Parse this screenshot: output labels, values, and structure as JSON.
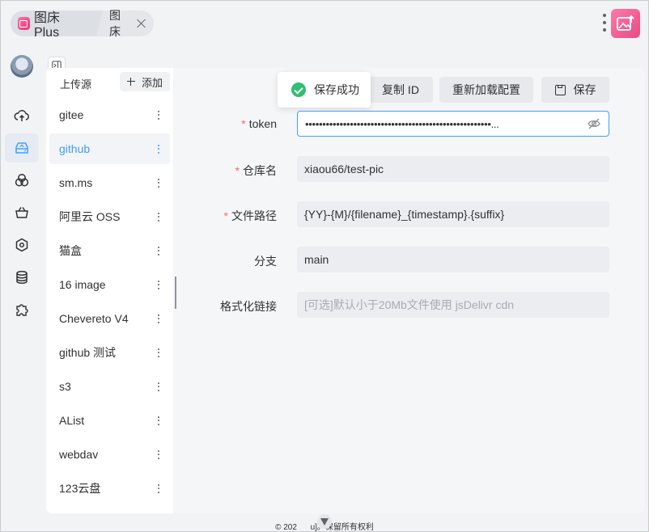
{
  "tabs": [
    {
      "label": "图床 Plus",
      "active": true
    },
    {
      "label": "图床",
      "active": false
    }
  ],
  "sidebar": {
    "title": "上传源",
    "add_label": "添加",
    "items": [
      "gitee",
      "github",
      "sm.ms",
      "阿里云 OSS",
      "猫盒",
      "16 image",
      "Chevereto V4",
      "github 测试",
      "s3",
      "AList",
      "webdav",
      "123云盘"
    ],
    "active_index": 1
  },
  "rail_icons": [
    "cloud-upload-icon",
    "image-host-icon",
    "circles-icon",
    "basket-icon",
    "hexagon-icon",
    "database-icon",
    "puzzle-icon"
  ],
  "toolbar": {
    "copy_id": "复制 ID",
    "reload": "重新加载配置",
    "save": "保存"
  },
  "toast": {
    "message": "保存成功"
  },
  "form": {
    "token": {
      "label": "token",
      "required": true,
      "value": "••••••••••••••••••••••••••••••••••••••••••••••••••••••..."
    },
    "repo": {
      "label": "仓库名",
      "required": true,
      "value": "xiaou66/test-pic"
    },
    "path": {
      "label": "文件路径",
      "required": true,
      "value": "{YY}-{M}/{filename}_{timestamp}.{suffix}"
    },
    "branch": {
      "label": "分支",
      "required": false,
      "value": "main"
    },
    "format": {
      "label": "格式化链接",
      "required": false,
      "placeholder": "[可选]默认小于20Mb文件使用 jsDelivr cdn"
    }
  },
  "footer": {
    "text": "© 202      u]。保留所有权利"
  },
  "colors": {
    "accent": "#409eff",
    "required": "#f56c6c",
    "success": "#2fbf71",
    "brand": "#e8337a"
  }
}
